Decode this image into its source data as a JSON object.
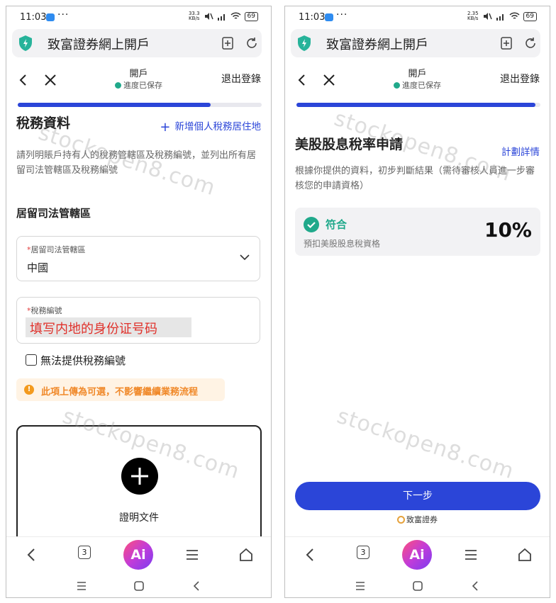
{
  "status_bar": {
    "time": "11:03",
    "speed_left": "33.3",
    "speed_right": "2.35",
    "speed_unit": "KB/s",
    "battery": "69"
  },
  "browser": {
    "title": "致富證券網上開戶"
  },
  "nav": {
    "title": "開戶",
    "saved": "進度已保存",
    "logout": "退出登錄"
  },
  "left_screen": {
    "progress": 0.79,
    "section_title": "稅務資料",
    "add_residence": "新增個人稅務居住地",
    "description": "請列明賬戶持有人的稅務管轄區及稅務編號，並列出所有居留司法管轄區及稅務編號",
    "subsection_title": "居留司法管轄區",
    "jurisdiction_field": {
      "required_mark": "*",
      "label": "居留司法管轄區",
      "value": "中國"
    },
    "tax_id_field": {
      "required_mark": "*",
      "label": "稅務編號",
      "annotation": "填写内地的身份证号码"
    },
    "no_tax_id_label": "無法提供稅務編號",
    "notice": "此項上傳為可選，不影響繼續業務流程",
    "upload_label": "證明文件"
  },
  "right_screen": {
    "progress": 0.98,
    "section_title": "美股股息稅率申請",
    "plan_details": "計劃詳情",
    "description": "根據你提供的資料，初步判斷結果（需待審核人員進一步審核您的申請資格）",
    "result": {
      "status": "符合",
      "subtitle": "預扣美股股息稅資格",
      "rate": "10%"
    },
    "next_button": "下一步",
    "brand": "致富證券"
  },
  "bottom_nav": {
    "tab_count": "3",
    "ai_label": "Ai"
  },
  "watermark": "stockopen8.com",
  "colors": {
    "accent_blue": "#2b45d8",
    "success_green": "#20a98b",
    "notice_orange": "#f0892a",
    "annotation_red": "#e0312b"
  }
}
